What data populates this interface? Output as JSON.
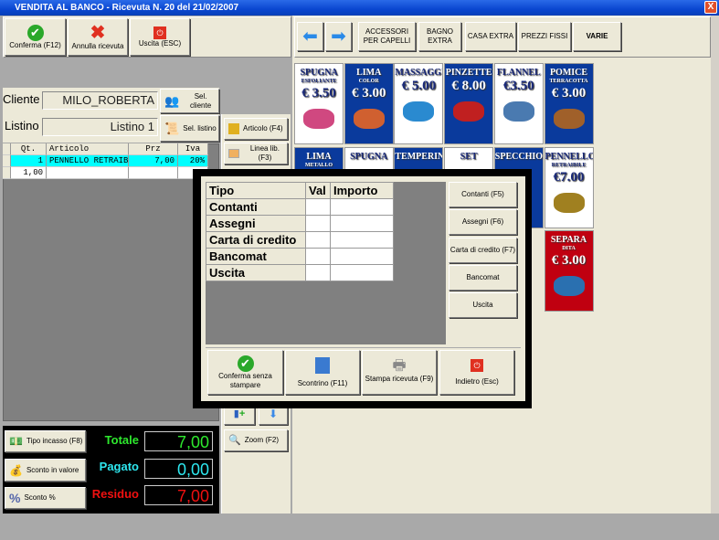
{
  "window": {
    "title": "VENDITA AL BANCO - Ricevuta N. 20 del 21/02/2007",
    "close": "X"
  },
  "toolbar": {
    "confirm": "Conferma (F12)",
    "cancel": "Annulla ricevuta",
    "exit": "Uscita (ESC)"
  },
  "categories": [
    "ACCESSORI PER CAPELLI",
    "BAGNO EXTRA",
    "CASA EXTRA",
    "PREZZI FISSI",
    "VARIE"
  ],
  "tiles": [
    {
      "t": "SPUGNA",
      "s": "ESFOLIANTE",
      "p": "€ 3.50",
      "bg": "#ffffff",
      "fg": "#1a2a7a",
      "img": "#d04880"
    },
    {
      "t": "LIMA",
      "s": "COLOR",
      "p": "€ 3.00",
      "bg": "#0a3a9c",
      "fg": "#ffffff",
      "img": "#d06030"
    },
    {
      "t": "MASSAGGIATORI",
      "s": "",
      "p": "€ 5.00",
      "bg": "#ffffff",
      "fg": "#1a2a7a",
      "img": "#2a8ad0"
    },
    {
      "t": "PINZETTE",
      "s": "",
      "p": "€ 8.00",
      "bg": "#0a3a9c",
      "fg": "#ffffff",
      "img": "#c02020"
    },
    {
      "t": "FLANNEL",
      "s": "",
      "p": "€3.50",
      "bg": "#ffffff",
      "fg": "#1a2a7a",
      "img": "#4a7ab0"
    },
    {
      "t": "POMICE",
      "s": "TERRACOTTA",
      "p": "€ 3.00",
      "bg": "#0a3a9c",
      "fg": "#ffffff",
      "img": "#a0602a"
    },
    {
      "t": "LIMA",
      "s": "METALLO",
      "p": "",
      "bg": "#0a3a9c",
      "fg": "#ffffff",
      "img": ""
    },
    {
      "t": "SPUGNA",
      "s": "",
      "p": "",
      "bg": "#ffffff",
      "fg": "#1a2a7a",
      "img": ""
    },
    {
      "t": "TEMPERINI",
      "s": "",
      "p": "",
      "bg": "#0a3a9c",
      "fg": "#ffffff",
      "img": ""
    },
    {
      "t": "SET",
      "s": "",
      "p": "",
      "bg": "#ffffff",
      "fg": "#1a2a7a",
      "img": ""
    },
    {
      "t": "SPECCHIO",
      "s": "",
      "p": "",
      "bg": "#0a3a9c",
      "fg": "#ffffff",
      "img": ""
    },
    {
      "t": "PENNELLO",
      "s": "RETRAIBILE",
      "p": "€7.00",
      "bg": "#ffffff",
      "fg": "#1a2a7a",
      "img": "#a08020"
    },
    {
      "t": "SEPARA",
      "s": "DITA",
      "p": "€ 3.00",
      "bg": "#c00010",
      "fg": "#ffffff",
      "img": "#2a70b0"
    }
  ],
  "customer": {
    "label": "Cliente",
    "value": "MILO_ROBERTA",
    "button": "Sel. cliente"
  },
  "pricelist": {
    "label": "Listino",
    "value": "Listino 1",
    "button": "Sel. listino"
  },
  "actions": {
    "article": "Articolo (F4)",
    "free_line": "Linea lib. (F3)",
    "zoom": "Zoom (F2)"
  },
  "items": {
    "headers": [
      "Qt.",
      "Articolo",
      "Prz",
      "Iva"
    ],
    "rows": [
      [
        "1",
        "PENNELLO RETRAIB",
        "7,00",
        "20%"
      ],
      [
        "1,00",
        "",
        "",
        ""
      ]
    ]
  },
  "totals": {
    "payment_type": "Tipo incasso (F8)",
    "discount_value": "Sconto in valore",
    "discount_pct": "Sconto %",
    "total_label": "Totale",
    "total": "7,00",
    "paid_label": "Pagato",
    "paid": "0,00",
    "rest_label": "Residuo",
    "rest": "7,00"
  },
  "payment": {
    "headers": [
      "Tipo",
      "Val",
      "Importo"
    ],
    "rows": [
      "Contanti",
      "Assegni",
      "Carta di credito",
      "Bancomat",
      "Uscita"
    ],
    "buttons": [
      "Contanti (F5)",
      "Assegni (F6)",
      "Carta di credito (F7)",
      "Bancomat",
      "Uscita"
    ],
    "confirm": "Conferma senza stampare",
    "receipt": "Scontrino (F11)",
    "print": "Stampa ricevuta (F9)",
    "back": "Indietro (Esc)"
  }
}
